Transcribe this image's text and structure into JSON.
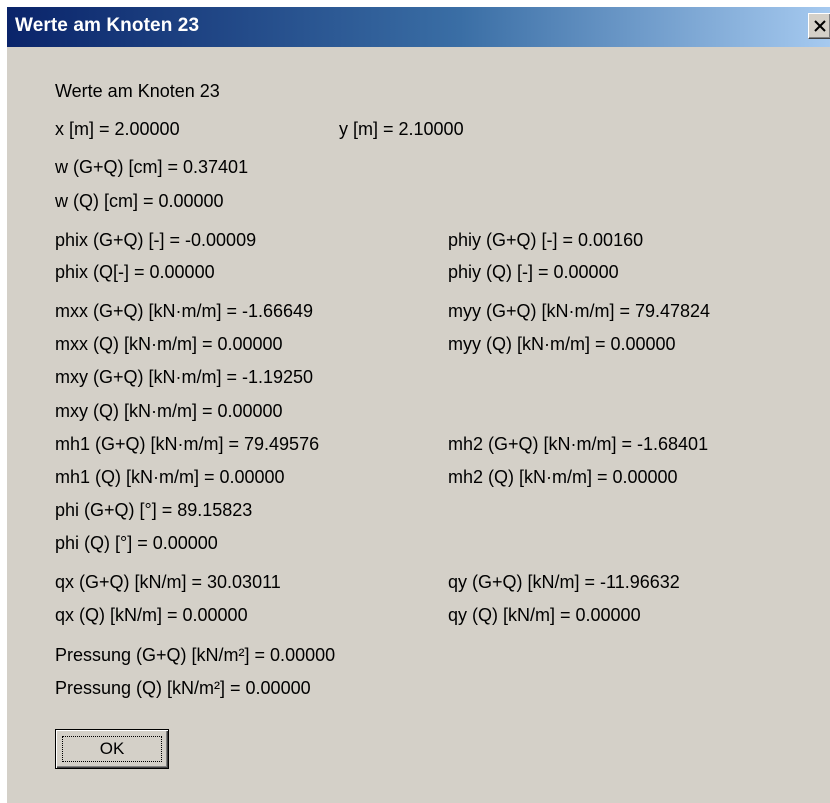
{
  "window": {
    "title": "Werte am Knoten 23",
    "close_symbol": "×"
  },
  "content": {
    "heading": "Werte am Knoten 23",
    "x": "x [m] = 2.00000",
    "y": "y [m] = 2.10000",
    "w_gq": "w (G+Q) [cm] = 0.37401",
    "w_q": "w (Q) [cm] = 0.00000",
    "phix_gq": "phix (G+Q) [-] = -0.00009",
    "phiy_gq": "phiy (G+Q) [-] = 0.00160",
    "phix_q": "phix (Q[-] = 0.00000",
    "phiy_q": "phiy (Q) [-] = 0.00000",
    "mxx_gq": "mxx (G+Q) [kN·m/m] = -1.66649",
    "myy_gq": "myy (G+Q) [kN·m/m] = 79.47824",
    "mxx_q": "mxx (Q) [kN·m/m] = 0.00000",
    "myy_q": "myy (Q) [kN·m/m] = 0.00000",
    "mxy_gq": "mxy (G+Q) [kN·m/m] = -1.19250",
    "mxy_q": "mxy (Q) [kN·m/m] = 0.00000",
    "mh1_gq": "mh1 (G+Q) [kN·m/m] = 79.49576",
    "mh2_gq": "mh2 (G+Q) [kN·m/m] = -1.68401",
    "mh1_q": "mh1 (Q) [kN·m/m] = 0.00000",
    "mh2_q": "mh2 (Q) [kN·m/m] = 0.00000",
    "phi_gq": "phi (G+Q) [°] = 89.15823",
    "phi_q": "phi (Q) [°] = 0.00000",
    "qx_gq": "qx (G+Q) [kN/m] = 30.03011",
    "qy_gq": "qy (G+Q) [kN/m] = -11.96632",
    "qx_q": "qx (Q) [kN/m] = 0.00000",
    "qy_q": "qy (Q) [kN/m] = 0.00000",
    "pressung_gq": "Pressung (G+Q) [kN/m²] = 0.00000",
    "pressung_q": "Pressung (Q) [kN/m²] = 0.00000"
  },
  "buttons": {
    "ok_label": "OK"
  }
}
